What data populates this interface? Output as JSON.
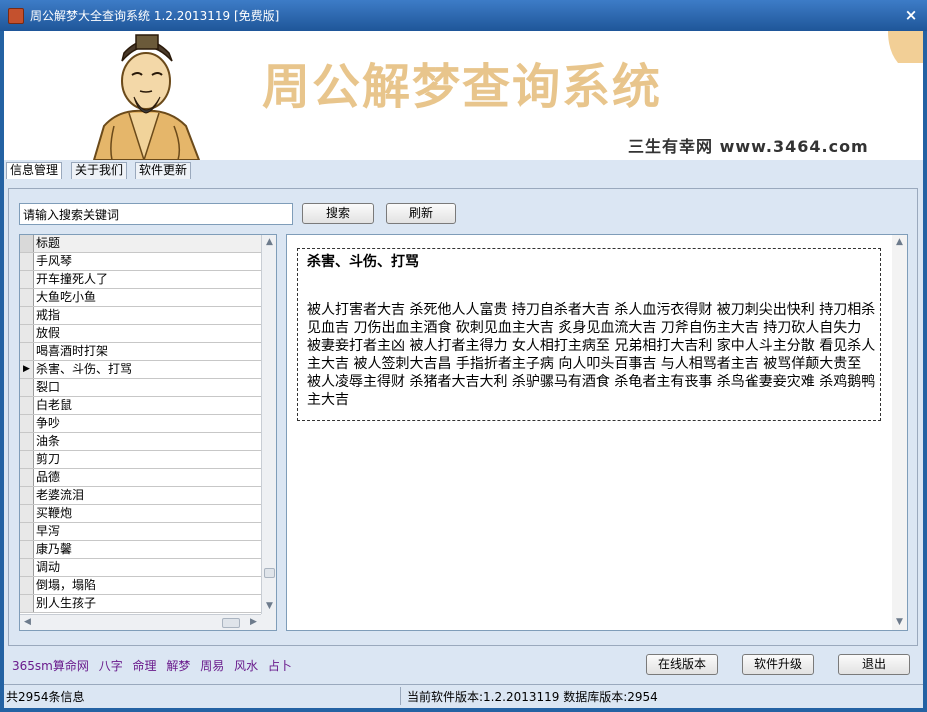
{
  "window": {
    "title": "周公解梦大全查询系统 1.2.2013119 [免费版]",
    "close_glyph": "×"
  },
  "banner": {
    "title": "周公解梦查询系统",
    "subtitle": "三生有幸网 www.3464.com"
  },
  "tabs": [
    {
      "label": "信息管理"
    },
    {
      "label": "关于我们"
    },
    {
      "label": "软件更新"
    }
  ],
  "search": {
    "value": "请输入搜索关键词",
    "search_label": "搜索",
    "refresh_label": "刷新"
  },
  "list": {
    "header": "标题",
    "current_indicator": "▶",
    "items": [
      "手风琴",
      "开车撞死人了",
      "大鱼吃小鱼",
      "戒指",
      "放假",
      "喝喜酒时打架",
      "杀害、斗伤、打骂",
      "裂口",
      "白老鼠",
      "争吵",
      "油条",
      "剪刀",
      "品德",
      "老婆流泪",
      "买鞭炮",
      "早泻",
      "康乃馨",
      "调动",
      "倒塌，塌陷",
      "别人生孩子"
    ]
  },
  "article": {
    "title": "杀害、斗伤、打骂",
    "body": "被人打害者大吉 杀死他人人富贵 持刀自杀者大吉 杀人血污衣得财 被刀刺尖出快利 持刀相杀见血吉 刀伤出血主酒食 砍刺见血主大吉 炙身见血流大吉 刀斧自伤主大吉 持刀砍人自失力 被妻妾打者主凶 被人打者主得力 女人相打主病至 兄弟相打大吉利 家中人斗主分散 看见杀人主大吉 被人签刺大吉昌 手指折者主子病 向人叩头百事吉 与人相骂者主吉 被骂佯颠大贵至 被人凌辱主得财 杀猪者大吉大利 杀驴骡马有酒食 杀龟者主有丧事 杀鸟雀妻妾灾难 杀鸡鹅鸭主大吉"
  },
  "footer_links": [
    "365sm算命网",
    "八字",
    "命理",
    "解梦",
    "周易",
    "风水",
    "占卜"
  ],
  "buttons": {
    "online": "在线版本",
    "upgrade": "软件升级",
    "exit": "退出"
  },
  "status": {
    "count": "共2954条信息",
    "version": "当前软件版本:1.2.2013119 数据库版本:2954"
  }
}
